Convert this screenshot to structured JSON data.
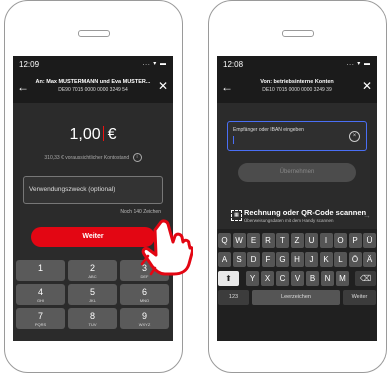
{
  "left_phone": {
    "status": {
      "time": "12:09",
      "icons": "... ▾ ▬"
    },
    "header": {
      "title": "An: Max MUSTERMANN und Eva MUSTER...",
      "iban": "DE90 7015 0000 0000 3249 54"
    },
    "amount": {
      "value": "1,00",
      "currency": "€"
    },
    "balance_text": "310,33 € voraussichtlicher Kontostand",
    "purpose_placeholder": "Verwendungszweck (optional)",
    "remaining_chars": "Noch 140 Zeichen",
    "submit_label": "Weiter",
    "numpad": [
      {
        "digit": "1",
        "letters": ""
      },
      {
        "digit": "2",
        "letters": "ABC"
      },
      {
        "digit": "3",
        "letters": "DEF"
      },
      {
        "digit": "4",
        "letters": "GHI"
      },
      {
        "digit": "5",
        "letters": "JKL"
      },
      {
        "digit": "6",
        "letters": "MNO"
      },
      {
        "digit": "7",
        "letters": "PQRS"
      },
      {
        "digit": "8",
        "letters": "TUV"
      },
      {
        "digit": "9",
        "letters": "WXYZ"
      }
    ]
  },
  "right_phone": {
    "status": {
      "time": "12:08",
      "icons": "... ▾ ▬"
    },
    "header": {
      "title": "Von: betriebsinterne Konten",
      "iban": "DE10 7015 0000 0000 3249 39"
    },
    "iban_placeholder": "Empfänger oder IBAN eingeben",
    "apply_label": "Übernehmen",
    "qr_title": "Rechnung oder QR-Code scannen",
    "qr_subtitle": "Überweisungsdaten mit dem Handy scannen",
    "keyboard": {
      "row1": [
        "Q",
        "W",
        "E",
        "R",
        "T",
        "Z",
        "U",
        "I",
        "O",
        "P",
        "Ü"
      ],
      "row2": [
        "A",
        "S",
        "D",
        "F",
        "G",
        "H",
        "J",
        "K",
        "L",
        "Ö",
        "Ä"
      ],
      "row3": [
        "Y",
        "X",
        "C",
        "V",
        "B",
        "N",
        "M"
      ],
      "numbers_key": "123",
      "space_key": "Leerzeichen",
      "enter_key": "Weiter"
    }
  },
  "colors": {
    "accent_red": "#e30613",
    "focus_blue": "#4a6ff5"
  }
}
